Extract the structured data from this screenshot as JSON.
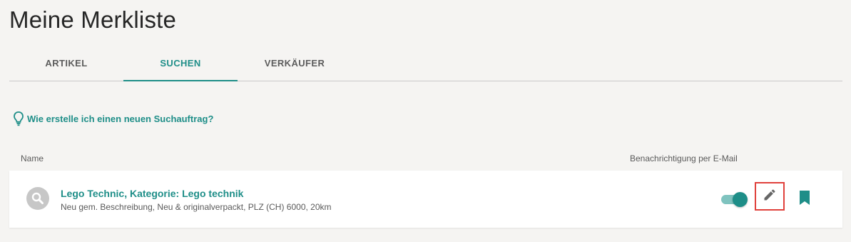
{
  "page": {
    "title": "Meine Merkliste"
  },
  "tabs": [
    {
      "label": "ARTIKEL",
      "active": false
    },
    {
      "label": "SUCHEN",
      "active": true
    },
    {
      "label": "VERKÄUFER",
      "active": false
    }
  ],
  "help": {
    "link_text": "Wie erstelle ich einen neuen Suchauftrag?",
    "icon": "lightbulb-icon"
  },
  "columns": {
    "name": "Name",
    "email_notification": "Benachrichtigung per E-Mail"
  },
  "saved_searches": [
    {
      "title": "Lego Technic, Kategorie: Lego technik",
      "details": "Neu gem. Beschreibung, Neu & originalverpackt, PLZ (CH) 6000, 20km",
      "email_notification_on": true,
      "icons": [
        "search-icon",
        "pencil-icon",
        "bookmark-icon"
      ]
    }
  ],
  "colors": {
    "accent": "#1e8e88",
    "accent_light": "#7fc3bf",
    "highlight_border": "#e0413c",
    "background": "#f5f4f2"
  }
}
